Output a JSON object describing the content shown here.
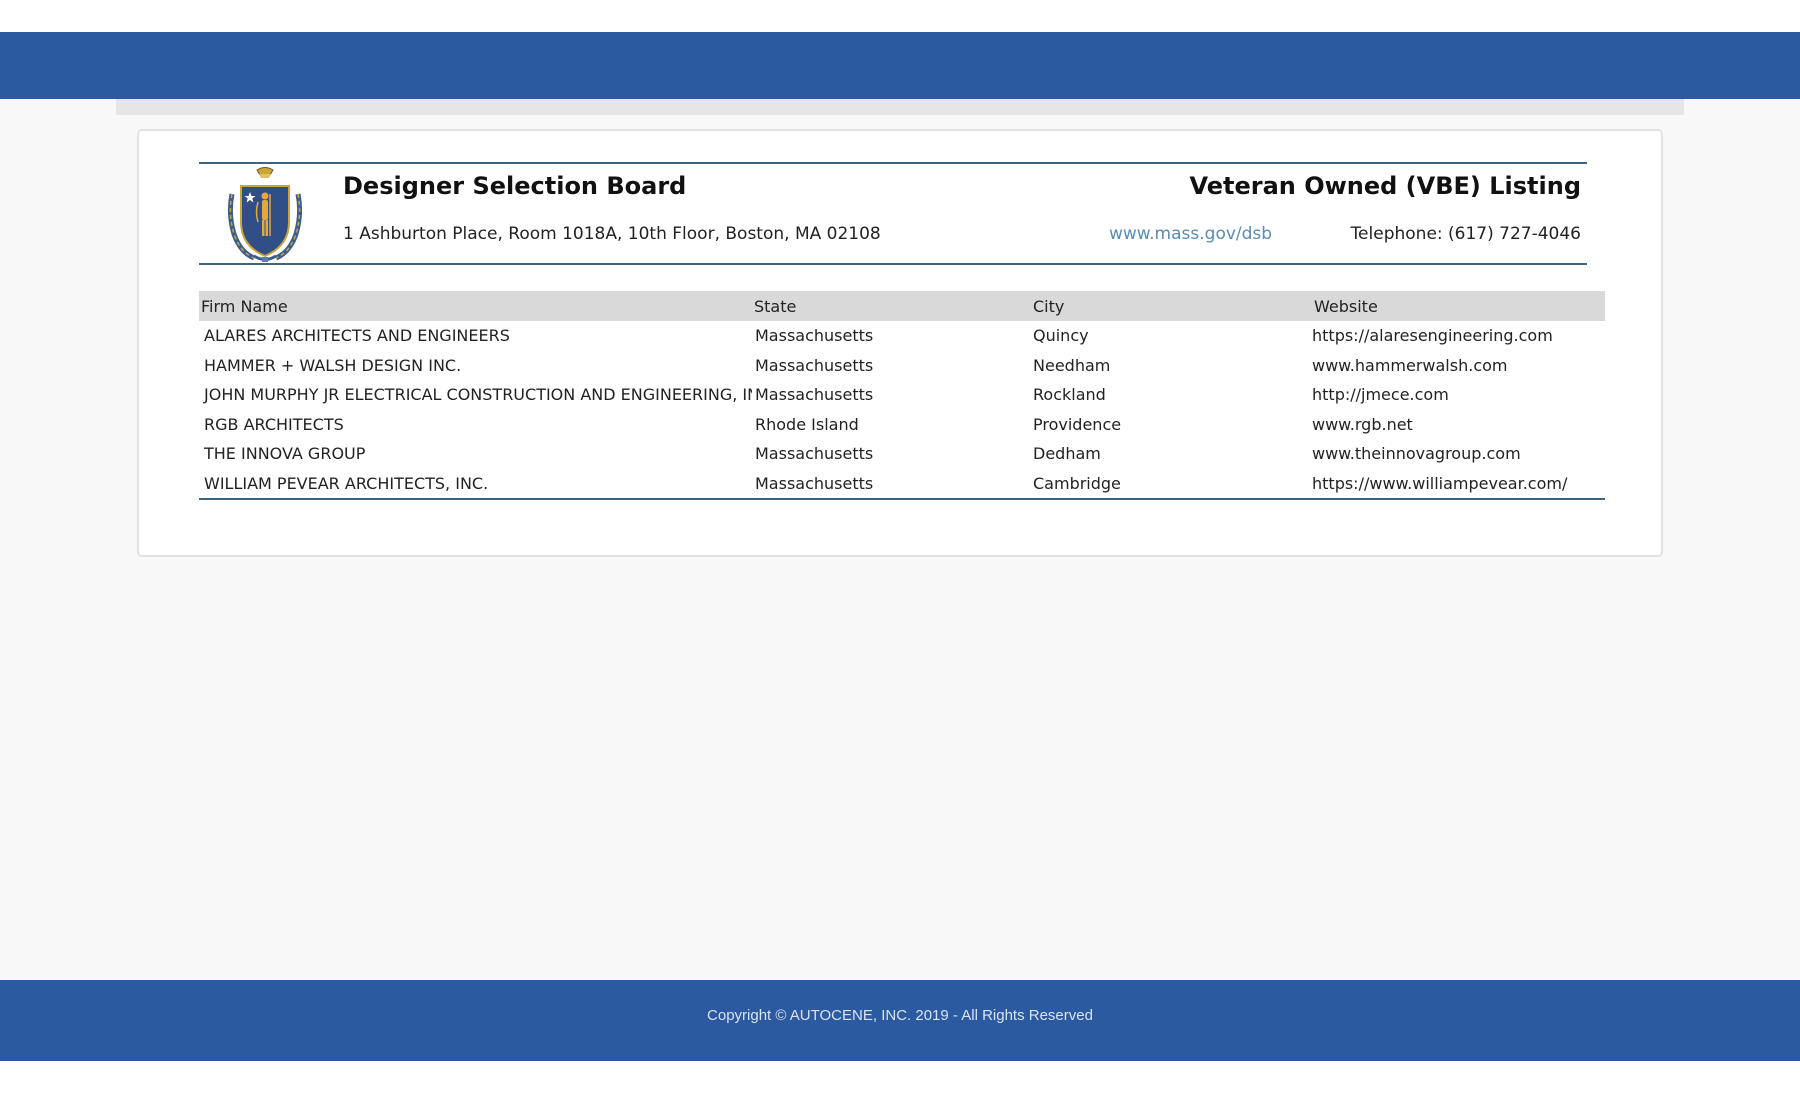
{
  "report": {
    "org_title": "Designer Selection Board",
    "listing_title": "Veteran Owned (VBE) Listing",
    "address": "1 Ashburton Place, Room 1018A, 10th Floor, Boston, MA 02108",
    "website_link": "www.mass.gov/dsb",
    "telephone": "Telephone: (617) 727-4046",
    "seal_icon": "massachusetts-seal-icon"
  },
  "table": {
    "headers": [
      "Firm Name",
      "State",
      "City",
      "Website"
    ],
    "rows": [
      [
        "ALARES ARCHITECTS AND ENGINEERS",
        "Massachusetts",
        "Quincy",
        "https://alaresengineering.com"
      ],
      [
        "HAMMER + WALSH DESIGN INC.",
        "Massachusetts",
        "Needham",
        "www.hammerwalsh.com"
      ],
      [
        "JOHN MURPHY JR ELECTRICAL CONSTRUCTION AND ENGINEERING, INC",
        "Massachusetts",
        "Rockland",
        "http://jmece.com"
      ],
      [
        "RGB ARCHITECTS",
        "Rhode Island",
        "Providence",
        "www.rgb.net"
      ],
      [
        "THE INNOVA GROUP",
        "Massachusetts",
        "Dedham",
        "www.theinnovagroup.com"
      ],
      [
        "WILLIAM PEVEAR ARCHITECTS, INC.",
        "Massachusetts",
        "Cambridge",
        "https://www.williampevear.com/"
      ]
    ]
  },
  "footer": {
    "copyright": "Copyright © AUTOCENE, INC. 2019 - All Rights Reserved"
  },
  "colors": {
    "header_blue": "#2c5aa0",
    "rule_blue": "#3e6482",
    "link": "#5a8cb0",
    "table_header_bg": "#d9d9d9"
  }
}
